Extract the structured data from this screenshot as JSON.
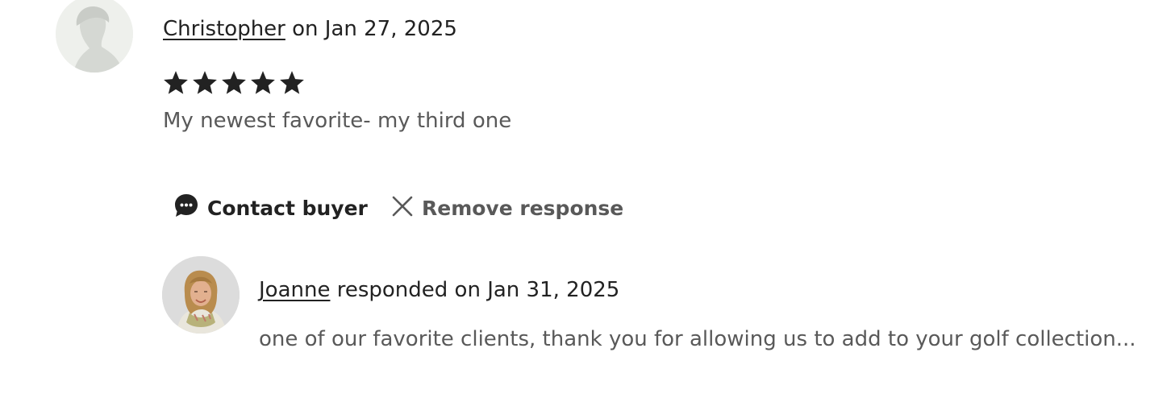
{
  "review": {
    "reviewer_name": "Christopher",
    "date_text": " on Jan 27, 2025",
    "rating": 5,
    "rating_max": 5,
    "text": "My newest favorite- my third one"
  },
  "actions": {
    "contact_label": "Contact buyer",
    "remove_label": "Remove response"
  },
  "response": {
    "seller_name": "Joanne",
    "date_text": " responded on Jan 31, 2025",
    "text": "one of our favorite clients, thank you for allowing us to add to your golf collection..."
  },
  "colors": {
    "text_primary": "#222222",
    "text_secondary": "#595959",
    "avatar_placeholder_bg": "#eef0ec"
  },
  "icons": {
    "reviewer_avatar": "default-person-silhouette",
    "star": "star-icon",
    "contact": "chat-bubble-icon",
    "remove": "close-icon",
    "seller_avatar": "seller-photo"
  }
}
